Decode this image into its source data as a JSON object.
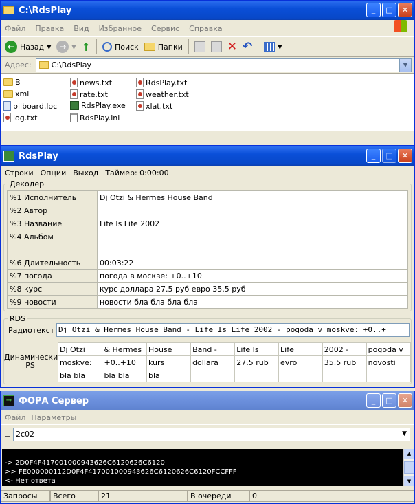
{
  "explorer": {
    "title": "C:\\RdsPlay",
    "menu": [
      "Файл",
      "Правка",
      "Вид",
      "Избранное",
      "Сервис",
      "Справка"
    ],
    "toolbar": {
      "back": "Назад",
      "search": "Поиск",
      "folders": "Папки"
    },
    "address_label": "Адрес:",
    "address_value": "C:\\RdsPlay",
    "files": [
      {
        "name": "B",
        "type": "folder"
      },
      {
        "name": "xml",
        "type": "folder"
      },
      {
        "name": "bilboard.loc",
        "type": "loc"
      },
      {
        "name": "log.txt",
        "type": "txt"
      },
      {
        "name": "news.txt",
        "type": "txt"
      },
      {
        "name": "rate.txt",
        "type": "txt"
      },
      {
        "name": "RdsPlay.exe",
        "type": "exe"
      },
      {
        "name": "RdsPlay.ini",
        "type": "ini"
      },
      {
        "name": "RdsPlay.txt",
        "type": "txt"
      },
      {
        "name": "weather.txt",
        "type": "txt"
      },
      {
        "name": "xlat.txt",
        "type": "txt"
      }
    ]
  },
  "rdsplay": {
    "title": "RdsPlay",
    "menu": [
      "Строки",
      "Опции",
      "Выход",
      "Таймер: 0:00:00"
    ],
    "decoder_label": "Декодер",
    "decoder_rows": [
      {
        "key": "%1 Исполнитель",
        "value": "Dj Otzi & Hermes House Band"
      },
      {
        "key": "%2 Автор",
        "value": ""
      },
      {
        "key": "%3 Название",
        "value": "Life Is Life 2002"
      },
      {
        "key": "%4 Альбом",
        "value": ""
      },
      {
        "key": "",
        "value": ""
      },
      {
        "key": "%6 Длительность",
        "value": "00:03:22"
      },
      {
        "key": "%7 погода",
        "value": "погода в москве: +0..+10"
      },
      {
        "key": "%8 курс",
        "value": "курс доллара 27.5 руб евро 35.5 руб"
      },
      {
        "key": "%9 новости",
        "value": "новости бла бла бла бла"
      }
    ],
    "rds_label": "RDS",
    "radiotext_label": "Радиотекст",
    "radiotext_value": "Dj Otzi & Hermes House Band - Life Is Life 2002 - pogoda v moskve: +0..+",
    "dps_label": "Динамический PS",
    "dps_rows": [
      [
        "Dj Otzi",
        "& Hermes",
        "House",
        "Band -",
        "Life Is",
        "Life",
        "2002 -",
        "pogoda v"
      ],
      [
        "moskve:",
        "+0..+10",
        "kurs",
        "dollara",
        "27.5 rub",
        "evro",
        "35.5 rub",
        "novosti"
      ],
      [
        "bla bla",
        "bla bla",
        "bla",
        "",
        "",
        "",
        "",
        ""
      ]
    ]
  },
  "fora": {
    "title": "ФОРА Сервер",
    "menu": [
      "Файл",
      "Параметры"
    ],
    "combo_value": "2c02",
    "console_lines": [
      "-> 2D0F4F417001000943626C6120626C6120",
      ">> FE000000112D0F4F417001000943626C6120626C6120FCCFFF",
      "<- Нет ответа"
    ],
    "status": [
      "Запросы",
      "Всего",
      "21",
      "В очереди",
      "0"
    ]
  }
}
